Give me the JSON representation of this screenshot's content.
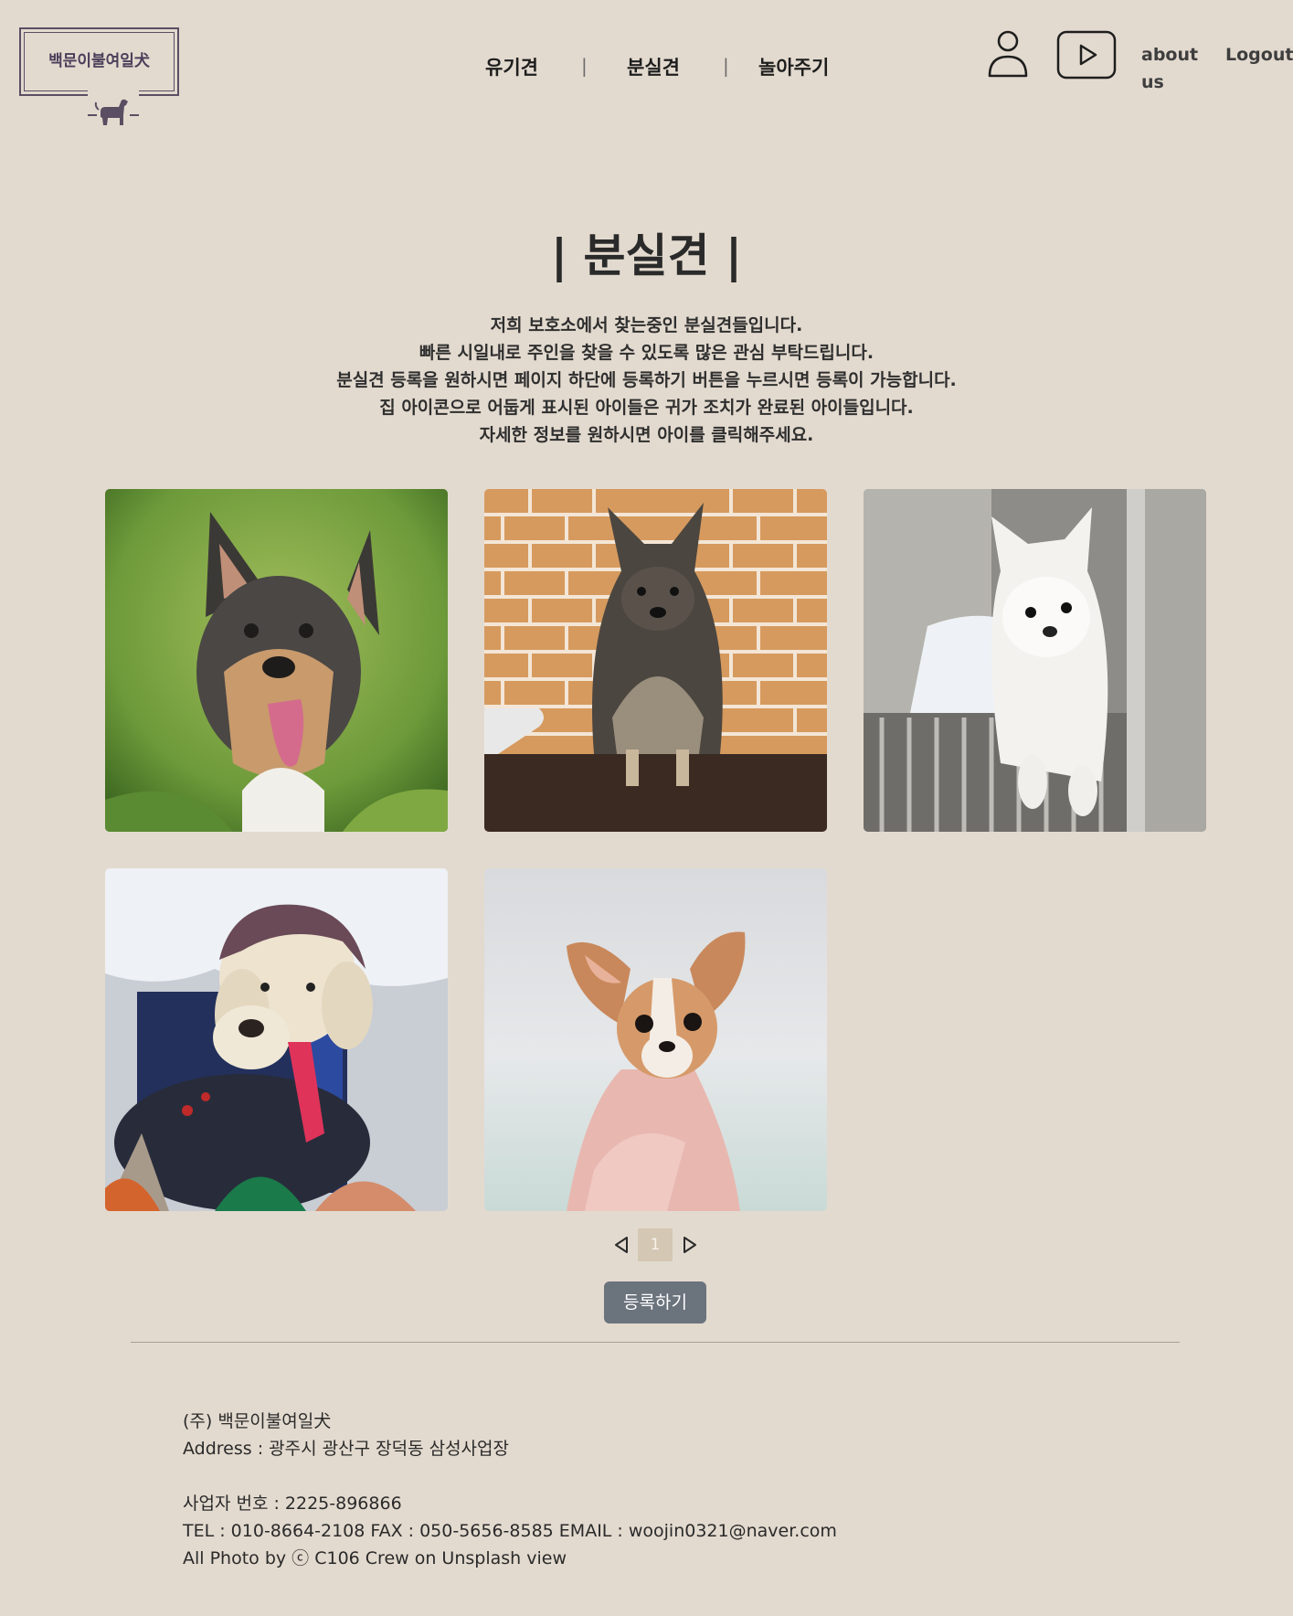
{
  "header": {
    "logo_text": "백문이불여일犬",
    "nav": [
      {
        "label": "유기견"
      },
      {
        "label": "분실견"
      },
      {
        "label": "놀아주기"
      }
    ],
    "nav_separator": "|",
    "icons": [
      "user-icon",
      "youtube-icon"
    ],
    "about_label": "about us",
    "logout_label": "Logout"
  },
  "main": {
    "title": "| 분실견 |",
    "intro_lines": [
      "저희 보호소에서 찾는중인 분실견들입니다.",
      "빠른 시일내로 주인을 찾을 수 있도록 많은 관심 부탁드립니다.",
      "분실견 등록을 원하시면 페이지 하단에 등록하기 버튼을 누르시면 등록이 가능합니다.",
      "집 아이콘으로 어둡게 표시된 아이들은 귀가 조치가 완료된 아이들입니다.",
      "자세한 정보를 원하시면 아이를 클릭해주세요."
    ],
    "dogs": [
      {
        "image": "shepherd-mix-on-grass"
      },
      {
        "image": "fluffy-dark-pomeranian-brick-wall"
      },
      {
        "image": "white-pomeranian-in-cage"
      },
      {
        "image": "poodle-with-bonnet"
      },
      {
        "image": "chihuahua-sitting"
      }
    ]
  },
  "pagination": {
    "current_page": "1",
    "prev_icon": "triangle-left-icon",
    "next_icon": "triangle-right-icon"
  },
  "register_button": "등록하기",
  "footer": {
    "company": "(주) 백문이불여일犬",
    "address": "Address : 광주시 광산구 장덕동 삼성사업장",
    "business_number": "사업자 번호 : 2225-896866",
    "contact": "TEL : 010-8664-2108 FAX : 050-5656-8585 EMAIL : woojin0321@naver.com",
    "credit": "All Photo by ⓒ C106 Crew on Unsplash view"
  },
  "colors": {
    "background": "#e3dacf",
    "button": "#6b737d",
    "page_active": "#d4c7b3",
    "logo": "#5a4e63"
  }
}
